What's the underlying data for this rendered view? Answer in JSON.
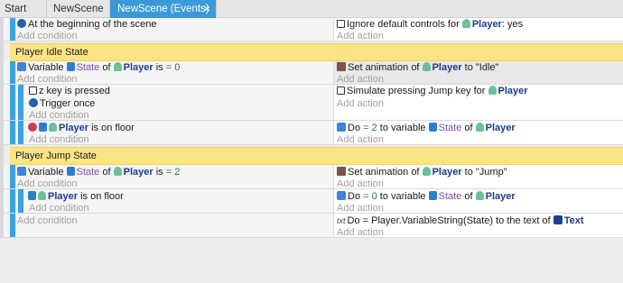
{
  "tabs": [
    {
      "label": "Start Page"
    },
    {
      "label": "NewScene"
    },
    {
      "label": "NewScene (Events)",
      "close": "×"
    }
  ],
  "events": {
    "add_condition": "Add condition",
    "add_action": "Add action",
    "e1": {
      "cond": "At the beginning of the scene",
      "act_prefix": "Ignore default controls for",
      "act_obj": "Player",
      "act_suffix": ": yes"
    },
    "comment1": "Player Idle State",
    "e2": {
      "cond_a": "Variable",
      "cond_var": "State",
      "cond_of": "of",
      "cond_obj": "Player",
      "cond_is": "is",
      "cond_val": "= 0",
      "act_prefix": "Set animation of",
      "act_obj": "Player",
      "act_to": "to \"Idle\""
    },
    "e3": {
      "cond1": "z key is pressed",
      "cond2": "Trigger once",
      "act_prefix": "Simulate pressing Jump key for",
      "act_obj": "Player"
    },
    "e4": {
      "cond_obj": "Player",
      "cond_suffix": "is on floor",
      "act_do": "Do",
      "act_val": "= 2",
      "act_mid": "to variable",
      "act_var": "State",
      "act_of": "of",
      "act_obj": "Player"
    },
    "comment2": "Player Jump State",
    "e5": {
      "cond_a": "Variable",
      "cond_var": "State",
      "cond_of": "of",
      "cond_obj": "Player",
      "cond_is": "is",
      "cond_val": "= 2",
      "act_prefix": "Set animation of",
      "act_obj": "Player",
      "act_to": "to \"Jump\""
    },
    "e6": {
      "cond_obj": "Player",
      "cond_suffix": "is on floor",
      "act_do": "Do",
      "act_val": "= 0",
      "act_mid": "to variable",
      "act_var": "State",
      "act_of": "of",
      "act_obj": "Player"
    },
    "e7": {
      "act_do": "Do",
      "act_expr": "= Player.VariableString(State)",
      "act_mid": "to the text of",
      "act_obj": "Text"
    }
  },
  "colors": {
    "accent": "#3a9ad9",
    "event_bar": "#3aa2e6",
    "comment_bg": "#fbe486"
  },
  "icons": [
    "scene-start-icon",
    "controls-icon",
    "variable-icon",
    "animation-icon",
    "keyboard-icon",
    "trigger-once-icon",
    "player-icon",
    "invert-icon",
    "platformer-icon",
    "text-object-icon"
  ]
}
